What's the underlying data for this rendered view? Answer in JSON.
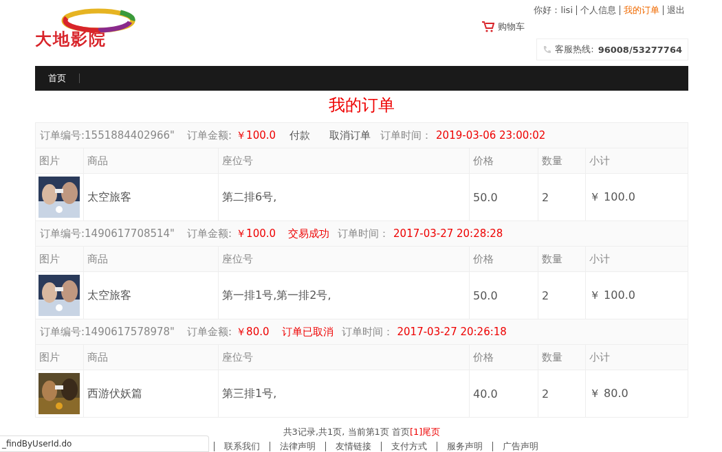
{
  "logo": {
    "text": "大地影院"
  },
  "top_links": [
    {
      "label": "你好：lisi",
      "selected": false
    },
    {
      "label": "个人信息",
      "selected": false
    },
    {
      "label": "我的订单",
      "selected": true
    },
    {
      "label": "退出",
      "selected": false
    }
  ],
  "cart": {
    "label": "购物车"
  },
  "hotline": {
    "label": "客服热线:",
    "number": "96008/53277764"
  },
  "nav": [
    {
      "label": "首页"
    }
  ],
  "page_title": "我的订单",
  "orders": [
    {
      "columns": [
        "图片",
        "商品",
        "座位号",
        "价格",
        "数量",
        "小计"
      ],
      "number": "订单编号:1551884402966\"",
      "amount_label": "订单金额:",
      "amount": "￥100.0",
      "actions": [
        {
          "kind": "link",
          "label": "付款"
        },
        {
          "kind": "link",
          "label": "取消订单"
        }
      ],
      "time_label": "订单时间：",
      "time": "2019-03-06 23:00:02",
      "items": [
        {
          "name": "太空旅客",
          "seats": "第二排6号,",
          "price": "50.0",
          "qty": "2",
          "subtotal": "￥ 100.0"
        }
      ]
    },
    {
      "columns": [
        "图片",
        "商品",
        "座位号",
        "价格",
        "数量",
        "小计"
      ],
      "number": "订单编号:1490617708514\"",
      "amount_label": "订单金额:",
      "amount": "￥100.0",
      "actions": [
        {
          "kind": "status",
          "label": "交易成功"
        }
      ],
      "time_label": "订单时间：",
      "time": "2017-03-27 20:28:28",
      "items": [
        {
          "name": "太空旅客",
          "seats": "第一排1号,第一排2号,",
          "price": "50.0",
          "qty": "2",
          "subtotal": "￥ 100.0"
        }
      ]
    },
    {
      "columns": [
        "图片",
        "商品",
        "座位号",
        "价格",
        "数量",
        "小计"
      ],
      "number": "订单编号:1490617578978\"",
      "amount_label": "订单金额:",
      "amount": "￥80.0",
      "actions": [
        {
          "kind": "status",
          "label": "订单已取消"
        }
      ],
      "time_label": "订单时间：",
      "time": "2017-03-27 20:26:18",
      "items": [
        {
          "name": "西游伏妖篇",
          "seats": "第三排1号,",
          "price": "40.0",
          "qty": "2",
          "subtotal": "￥ 80.0"
        }
      ]
    }
  ],
  "pager": {
    "summary": "共3记录,共1页, 当前第1页 首页",
    "current": "[1]",
    "last": "尾页"
  },
  "footer_links": [
    "联系我们",
    "法律声明",
    "友情链接",
    "支付方式",
    "服务声明",
    "广告声明"
  ],
  "status_url": "_findByUserId.do"
}
